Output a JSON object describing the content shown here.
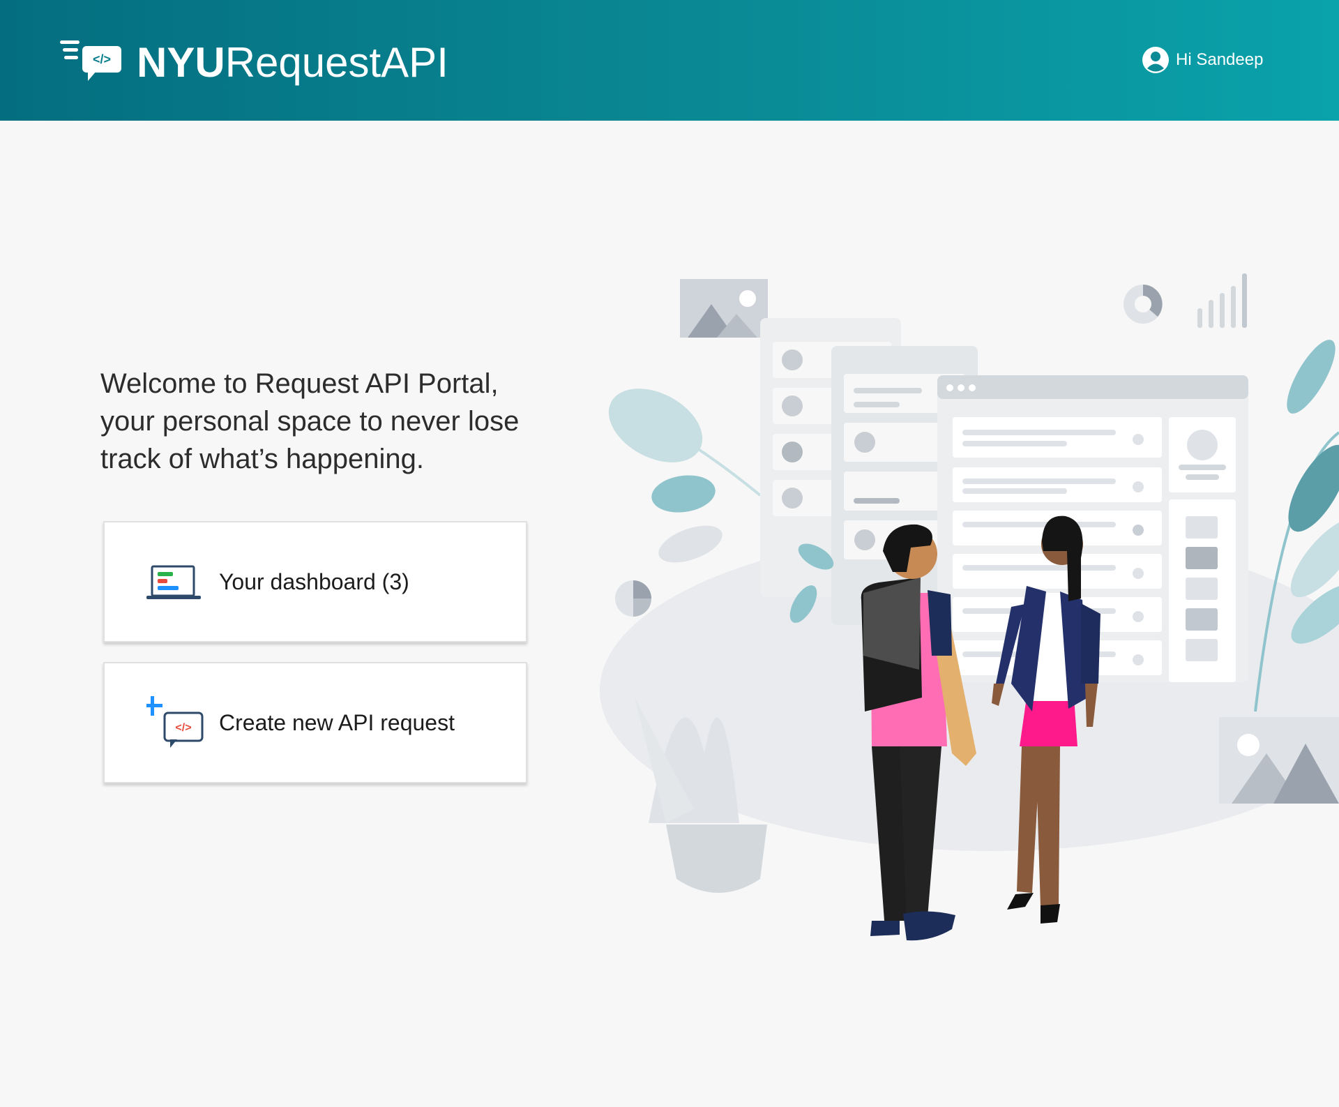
{
  "header": {
    "brand_bold": "NYU",
    "brand_light": "RequestAPI",
    "user_greeting": "Hi Sandeep"
  },
  "welcome": {
    "line1": "Welcome to Request API Portal,",
    "line2": "your personal space to never lose",
    "line3": "track of what’s happening."
  },
  "actions": [
    {
      "label": "Your dashboard (3)",
      "icon": "laptop-dashboard-icon"
    },
    {
      "label": "Create new API request",
      "icon": "add-api-request-icon"
    }
  ],
  "colors": {
    "header_start": "#046e80",
    "header_end": "#0aa2ab",
    "background": "#f7f7f7",
    "accent_pink": "#ff1a8c",
    "accent_blue": "#1e90ff"
  }
}
